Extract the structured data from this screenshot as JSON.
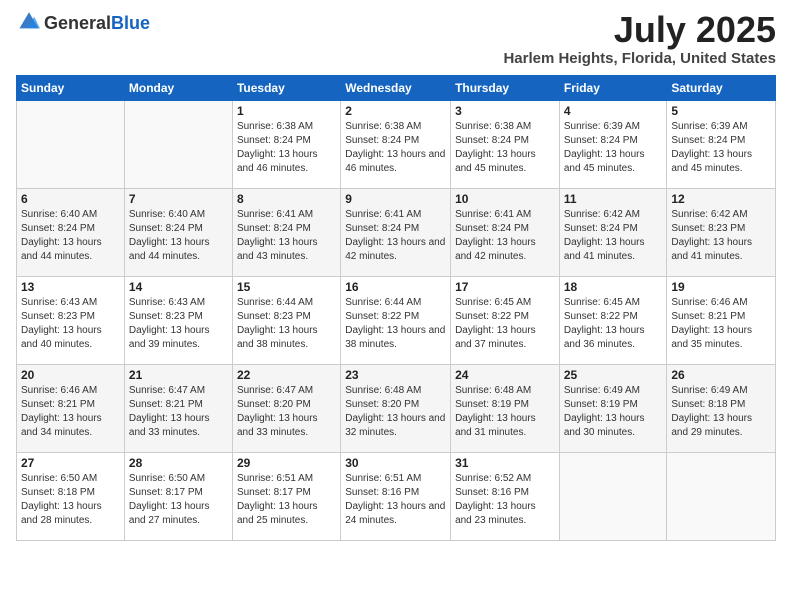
{
  "logo": {
    "general": "General",
    "blue": "Blue"
  },
  "title": "July 2025",
  "location": "Harlem Heights, Florida, United States",
  "weekdays": [
    "Sunday",
    "Monday",
    "Tuesday",
    "Wednesday",
    "Thursday",
    "Friday",
    "Saturday"
  ],
  "weeks": [
    [
      {
        "day": "",
        "info": ""
      },
      {
        "day": "",
        "info": ""
      },
      {
        "day": "1",
        "info": "Sunrise: 6:38 AM\nSunset: 8:24 PM\nDaylight: 13 hours and 46 minutes."
      },
      {
        "day": "2",
        "info": "Sunrise: 6:38 AM\nSunset: 8:24 PM\nDaylight: 13 hours and 46 minutes."
      },
      {
        "day": "3",
        "info": "Sunrise: 6:38 AM\nSunset: 8:24 PM\nDaylight: 13 hours and 45 minutes."
      },
      {
        "day": "4",
        "info": "Sunrise: 6:39 AM\nSunset: 8:24 PM\nDaylight: 13 hours and 45 minutes."
      },
      {
        "day": "5",
        "info": "Sunrise: 6:39 AM\nSunset: 8:24 PM\nDaylight: 13 hours and 45 minutes."
      }
    ],
    [
      {
        "day": "6",
        "info": "Sunrise: 6:40 AM\nSunset: 8:24 PM\nDaylight: 13 hours and 44 minutes."
      },
      {
        "day": "7",
        "info": "Sunrise: 6:40 AM\nSunset: 8:24 PM\nDaylight: 13 hours and 44 minutes."
      },
      {
        "day": "8",
        "info": "Sunrise: 6:41 AM\nSunset: 8:24 PM\nDaylight: 13 hours and 43 minutes."
      },
      {
        "day": "9",
        "info": "Sunrise: 6:41 AM\nSunset: 8:24 PM\nDaylight: 13 hours and 42 minutes."
      },
      {
        "day": "10",
        "info": "Sunrise: 6:41 AM\nSunset: 8:24 PM\nDaylight: 13 hours and 42 minutes."
      },
      {
        "day": "11",
        "info": "Sunrise: 6:42 AM\nSunset: 8:24 PM\nDaylight: 13 hours and 41 minutes."
      },
      {
        "day": "12",
        "info": "Sunrise: 6:42 AM\nSunset: 8:23 PM\nDaylight: 13 hours and 41 minutes."
      }
    ],
    [
      {
        "day": "13",
        "info": "Sunrise: 6:43 AM\nSunset: 8:23 PM\nDaylight: 13 hours and 40 minutes."
      },
      {
        "day": "14",
        "info": "Sunrise: 6:43 AM\nSunset: 8:23 PM\nDaylight: 13 hours and 39 minutes."
      },
      {
        "day": "15",
        "info": "Sunrise: 6:44 AM\nSunset: 8:23 PM\nDaylight: 13 hours and 38 minutes."
      },
      {
        "day": "16",
        "info": "Sunrise: 6:44 AM\nSunset: 8:22 PM\nDaylight: 13 hours and 38 minutes."
      },
      {
        "day": "17",
        "info": "Sunrise: 6:45 AM\nSunset: 8:22 PM\nDaylight: 13 hours and 37 minutes."
      },
      {
        "day": "18",
        "info": "Sunrise: 6:45 AM\nSunset: 8:22 PM\nDaylight: 13 hours and 36 minutes."
      },
      {
        "day": "19",
        "info": "Sunrise: 6:46 AM\nSunset: 8:21 PM\nDaylight: 13 hours and 35 minutes."
      }
    ],
    [
      {
        "day": "20",
        "info": "Sunrise: 6:46 AM\nSunset: 8:21 PM\nDaylight: 13 hours and 34 minutes."
      },
      {
        "day": "21",
        "info": "Sunrise: 6:47 AM\nSunset: 8:21 PM\nDaylight: 13 hours and 33 minutes."
      },
      {
        "day": "22",
        "info": "Sunrise: 6:47 AM\nSunset: 8:20 PM\nDaylight: 13 hours and 33 minutes."
      },
      {
        "day": "23",
        "info": "Sunrise: 6:48 AM\nSunset: 8:20 PM\nDaylight: 13 hours and 32 minutes."
      },
      {
        "day": "24",
        "info": "Sunrise: 6:48 AM\nSunset: 8:19 PM\nDaylight: 13 hours and 31 minutes."
      },
      {
        "day": "25",
        "info": "Sunrise: 6:49 AM\nSunset: 8:19 PM\nDaylight: 13 hours and 30 minutes."
      },
      {
        "day": "26",
        "info": "Sunrise: 6:49 AM\nSunset: 8:18 PM\nDaylight: 13 hours and 29 minutes."
      }
    ],
    [
      {
        "day": "27",
        "info": "Sunrise: 6:50 AM\nSunset: 8:18 PM\nDaylight: 13 hours and 28 minutes."
      },
      {
        "day": "28",
        "info": "Sunrise: 6:50 AM\nSunset: 8:17 PM\nDaylight: 13 hours and 27 minutes."
      },
      {
        "day": "29",
        "info": "Sunrise: 6:51 AM\nSunset: 8:17 PM\nDaylight: 13 hours and 25 minutes."
      },
      {
        "day": "30",
        "info": "Sunrise: 6:51 AM\nSunset: 8:16 PM\nDaylight: 13 hours and 24 minutes."
      },
      {
        "day": "31",
        "info": "Sunrise: 6:52 AM\nSunset: 8:16 PM\nDaylight: 13 hours and 23 minutes."
      },
      {
        "day": "",
        "info": ""
      },
      {
        "day": "",
        "info": ""
      }
    ]
  ]
}
